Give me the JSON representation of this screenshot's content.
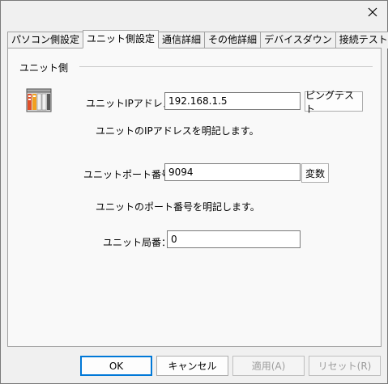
{
  "window": {
    "close_icon": "close-icon"
  },
  "tabs": [
    {
      "label": "パソコン側設定",
      "active": false
    },
    {
      "label": "ユニット側設定",
      "active": true
    },
    {
      "label": "通信詳細",
      "active": false
    },
    {
      "label": "その他詳細",
      "active": false
    },
    {
      "label": "デバイスダウン",
      "active": false
    },
    {
      "label": "接続テスト",
      "active": false
    }
  ],
  "panel": {
    "group_title": "ユニット側",
    "ip": {
      "label": "ユニットIPアドレス：",
      "value": "192.168.1.5",
      "button": "ピングテスト",
      "description": "ユニットのIPアドレスを明記します。"
    },
    "port": {
      "label": "ユニットポート番号：",
      "value": "9094",
      "button": "変数",
      "description": "ユニットのポート番号を明記します。"
    },
    "station": {
      "label": "ユニット局番：",
      "value": "0"
    }
  },
  "buttons": {
    "ok": "OK",
    "cancel": "キャンセル",
    "apply": "適用(A)",
    "reset": "リセット(R)"
  }
}
